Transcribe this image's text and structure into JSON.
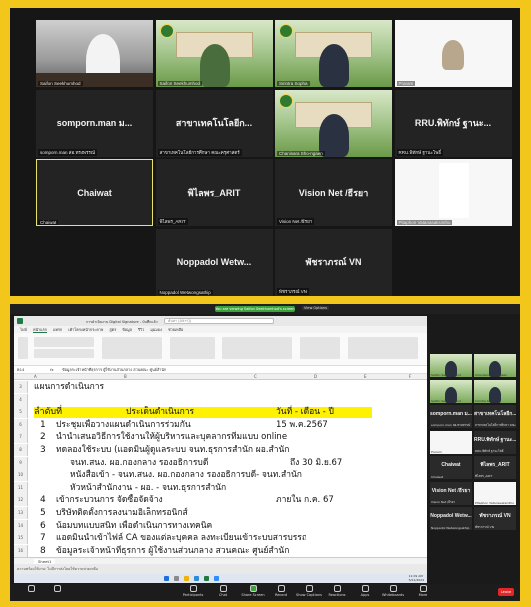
{
  "meeting_tiles": [
    {
      "name": "",
      "label": "Saifon Seekhumhod",
      "kind": "room"
    },
    {
      "name": "",
      "label": "Saifon Seekhumhod",
      "kind": "green"
    },
    {
      "name": "",
      "label": "Sirintra Sopha",
      "kind": "green"
    },
    {
      "name": "",
      "label": "Praram",
      "kind": "white"
    },
    {
      "name": "somporn.man ม...",
      "label": "somporn.man สอ.ทรงพรรณ์",
      "kind": "dark"
    },
    {
      "name": "สาขาเทคโนโลยีก...",
      "label": "สาขาเทคโนโลยีการศึกษา คณะครุศาสตร์",
      "kind": "dark"
    },
    {
      "name": "",
      "label": "Chanisara Sho-ngaen",
      "kind": "green"
    },
    {
      "name": "RRU.พิทักษ์ ฐานะ...",
      "label": "RRU.พิทักษ์ ฐานะโพธิ์",
      "kind": "dark"
    },
    {
      "name": "Chaiwat",
      "label": "Chaiwat",
      "kind": "dark"
    },
    {
      "name": "พิไลพร_ARIT",
      "label": "พิไลพร_ARIT",
      "kind": "dark"
    },
    {
      "name": "Vision Net /ธีรยา",
      "label": "Vision Net /ธีรยา",
      "kind": "dark"
    },
    {
      "name": "",
      "label": "Pitaphon Vatanasaksinthu",
      "kind": "white"
    },
    {
      "name": "Noppadol Wetw...",
      "label": "Noppadol Wetwongsathip",
      "kind": "dark"
    },
    {
      "name": "พัชราภรณ์ VN",
      "label": "พัชราภรณ์ VN",
      "kind": "dark"
    }
  ],
  "share": {
    "banner": "You are viewing Saifon Seekhumhod's screen",
    "view_options": "View Options",
    "excel_title": "การดำเนินงาน Digital Signature - บันทึกแล้ว",
    "search_placeholder": "ค้นหา (Alt+Q)",
    "tabs": [
      "ไฟล์",
      "หน้าแรก",
      "แทรก",
      "เค้าโครงหน้ากระดาษ",
      "สูตร",
      "ข้อมูล",
      "รีวิว",
      "มุมมอง",
      "ช่วยเหลือ"
    ],
    "name_box": "B14",
    "formula": "ข้อมูลระเจ้าหน้าที่ธุรการ ผู้ใช้งานส่วนกลาง สวนคณะ ศูนย์สำนัก",
    "columns": [
      "A",
      "B",
      "C",
      "D",
      "E",
      "F"
    ],
    "sheet_tab": "Sheet1",
    "status": "ความพร้อมใช้งาน: ไม่มีการส่งโดยใช้ความช่วยเหลือ",
    "rows": [
      {
        "rn": "3",
        "num": "",
        "act": "แผนการดำเนินการ",
        "date": "",
        "hl": false
      },
      {
        "rn": "4",
        "num": "",
        "act": "",
        "date": "",
        "hl": false
      },
      {
        "rn": "5",
        "num": "ลำดับที่",
        "act": "ประเด็นดำเนินการ",
        "date": "วันที่ - เดือน - ปี",
        "hl": true
      },
      {
        "rn": "6",
        "num": "1",
        "act": "ประชุมเพื่อวางแผนดำเนินการร่วมกัน",
        "date": "15 พ.ค.2567",
        "hl": false
      },
      {
        "rn": "7",
        "num": "2",
        "act": "นำนำเสนอวิธีการใช้งานให้ผู้บริหารและบุคลากรทีมแบบ online",
        "date": "",
        "hl": false
      },
      {
        "rn": "8",
        "num": "3",
        "act": "ทดลองใช้ระบบ (แอดมินผู้ดูแลระบบ จนท.ธุรการสำนัก ผอ.สำนัก",
        "date": "",
        "hl": false
      },
      {
        "rn": "9",
        "num": "",
        "act": "จนท.สนง. ผอ.กองกลาง รองอธิการบดี",
        "date": "ถึง 30 มิ.ย.67",
        "hl": false
      },
      {
        "rn": "10",
        "num": "",
        "act": "หนังสือเข้า - จนท.สนง. ผอ.กองกลาง รองอธิการบดี- จนท.สำนัก",
        "date": "",
        "hl": false
      },
      {
        "rn": "11",
        "num": "",
        "act": "หัวหน้าสำนักงาน - ผอ. - จนท.ธุรการสำนัก",
        "date": "",
        "hl": false
      },
      {
        "rn": "12",
        "num": "4",
        "act": "เข้ากระบวนการ จัดซื้อจัดจ้าง",
        "date": "ภายใน ก.ค. 67",
        "hl": false
      },
      {
        "rn": "13",
        "num": "5",
        "act": "บริษัทติดตั้งการลงนามอิเล็กทรอนิกส์",
        "date": "",
        "hl": false
      },
      {
        "rn": "14",
        "num": "6",
        "act": "น้อมบทแบบสนิท เพื่อดำเนินการทางเทคนิค",
        "date": "",
        "hl": false
      },
      {
        "rn": "15",
        "num": "7",
        "act": "แอดมินนำเข้าไฟล์ CA ของแต่ละบุคคล ลงทะเบียนเข้าระบบสารบรรณฯ",
        "date": "",
        "hl": false
      },
      {
        "rn": "16",
        "num": "8",
        "act": "ข้อมูลระเจ้าหน้าที่ธุรการ ผู้ใช้งานส่วนกลาง สวนคณะ ศูนย์สำนัก",
        "date": "",
        "hl": false
      }
    ]
  },
  "side_tiles": [
    {
      "name": "",
      "label": "Saifon Seekhumhod"
    },
    {
      "name": "",
      "label": "Chanisara Sho-ngaen"
    },
    {
      "name": "",
      "label": "Saifon Seekhumhod"
    },
    {
      "name": "",
      "label": "Sirintra Sopha"
    },
    {
      "name": "somporn.man ม...",
      "label": "somporn.man สอ.ทรงพรรณ์"
    },
    {
      "name": "สาขาเทคโนโลยีก...",
      "label": "สาขาเทคโนโลยีการศึกษา คณะครุศาสตร์"
    },
    {
      "name": "",
      "label": "Praram"
    },
    {
      "name": "RRU.พิทักษ์ ฐานะ...",
      "label": "RRU.พิทักษ์ ฐานะโพธิ์"
    },
    {
      "name": "Chaiwat",
      "label": "Chaiwat"
    },
    {
      "name": "พิไลพร_ARIT",
      "label": "พิไลพร_ARIT"
    },
    {
      "name": "Vision Net /ธีรยา",
      "label": "Vision Net /ธีรยา"
    },
    {
      "name": "",
      "label": "Pitaphon Vatanasaksinthu"
    },
    {
      "name": "Noppadol Wetw...",
      "label": "Noppadol Wetwongsathip"
    },
    {
      "name": "พัชราภรณ์ VN",
      "label": "พัชราภรณ์ VN"
    }
  ],
  "zoom_controls": [
    "Participants",
    "Chat",
    "Share Screen",
    "Record",
    "Show Captions",
    "Reactions",
    "Apps",
    "Whiteboards",
    "More"
  ],
  "leave_label": "Leave",
  "clock": "11:09 AM\n5/21/2024"
}
